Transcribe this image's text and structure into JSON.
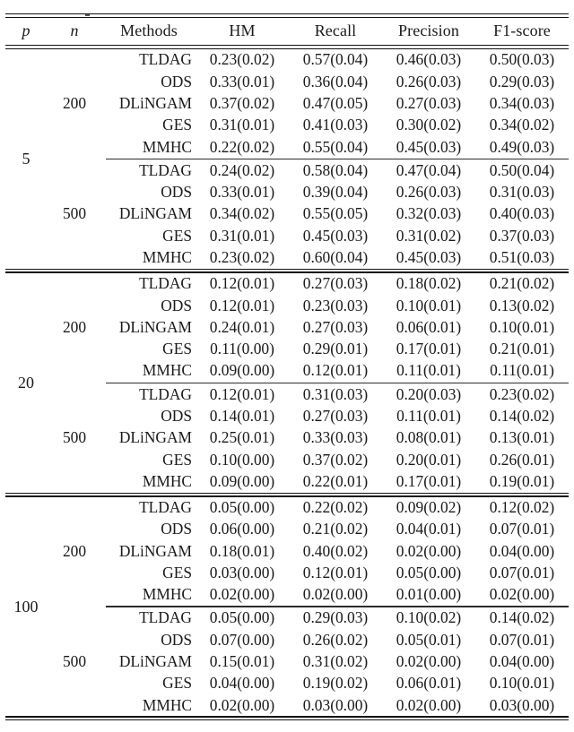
{
  "table": {
    "columns": [
      "p",
      "n",
      "Methods",
      "HM",
      "Recall",
      "Precision",
      "F1-score"
    ],
    "header": {
      "p": "p",
      "n": "n",
      "methods": "Methods",
      "hm": "HM",
      "recall": "Recall",
      "precision": "Precision",
      "f1": "F1-score"
    },
    "groups": [
      {
        "p": "5",
        "subgroups": [
          {
            "n": "200",
            "rows": [
              {
                "method": "TLDAG",
                "hm": "0.23(0.02)",
                "recall": "0.57(0.04)",
                "precision": "0.46(0.03)",
                "f1": "0.50(0.03)"
              },
              {
                "method": "ODS",
                "hm": "0.33(0.01)",
                "recall": "0.36(0.04)",
                "precision": "0.26(0.03)",
                "f1": "0.29(0.03)"
              },
              {
                "method": "DLiNGAM",
                "hm": "0.37(0.02)",
                "recall": "0.47(0.05)",
                "precision": "0.27(0.03)",
                "f1": "0.34(0.03)"
              },
              {
                "method": "GES",
                "hm": "0.31(0.01)",
                "recall": "0.41(0.03)",
                "precision": "0.30(0.02)",
                "f1": "0.34(0.02)"
              },
              {
                "method": "MMHC",
                "hm": "0.22(0.02)",
                "recall": "0.55(0.04)",
                "precision": "0.45(0.03)",
                "f1": "0.49(0.03)"
              }
            ]
          },
          {
            "n": "500",
            "rows": [
              {
                "method": "TLDAG",
                "hm": "0.24(0.02)",
                "recall": "0.58(0.04)",
                "precision": "0.47(0.04)",
                "f1": "0.50(0.04)"
              },
              {
                "method": "ODS",
                "hm": "0.33(0.01)",
                "recall": "0.39(0.04)",
                "precision": "0.26(0.03)",
                "f1": "0.31(0.03)"
              },
              {
                "method": "DLiNGAM",
                "hm": "0.34(0.02)",
                "recall": "0.55(0.05)",
                "precision": "0.32(0.03)",
                "f1": "0.40(0.03)"
              },
              {
                "method": "GES",
                "hm": "0.31(0.01)",
                "recall": "0.45(0.03)",
                "precision": "0.31(0.02)",
                "f1": "0.37(0.03)"
              },
              {
                "method": "MMHC",
                "hm": "0.23(0.02)",
                "recall": "0.60(0.04)",
                "precision": "0.45(0.03)",
                "f1": "0.51(0.03)"
              }
            ]
          }
        ]
      },
      {
        "p": "20",
        "subgroups": [
          {
            "n": "200",
            "rows": [
              {
                "method": "TLDAG",
                "hm": "0.12(0.01)",
                "recall": "0.27(0.03)",
                "precision": "0.18(0.02)",
                "f1": "0.21(0.02)"
              },
              {
                "method": "ODS",
                "hm": "0.12(0.01)",
                "recall": "0.23(0.03)",
                "precision": "0.10(0.01)",
                "f1": "0.13(0.02)"
              },
              {
                "method": "DLiNGAM",
                "hm": "0.24(0.01)",
                "recall": "0.27(0.03)",
                "precision": "0.06(0.01)",
                "f1": "0.10(0.01)"
              },
              {
                "method": "GES",
                "hm": "0.11(0.00)",
                "recall": "0.29(0.01)",
                "precision": "0.17(0.01)",
                "f1": "0.21(0.01)"
              },
              {
                "method": "MMHC",
                "hm": "0.09(0.00)",
                "recall": "0.12(0.01)",
                "precision": "0.11(0.01)",
                "f1": "0.11(0.01)"
              }
            ]
          },
          {
            "n": "500",
            "rows": [
              {
                "method": "TLDAG",
                "hm": "0.12(0.01)",
                "recall": "0.31(0.03)",
                "precision": "0.20(0.03)",
                "f1": "0.23(0.02)"
              },
              {
                "method": "ODS",
                "hm": "0.14(0.01)",
                "recall": "0.27(0.03)",
                "precision": "0.11(0.01)",
                "f1": "0.14(0.02)"
              },
              {
                "method": "DLiNGAM",
                "hm": "0.25(0.01)",
                "recall": "0.33(0.03)",
                "precision": "0.08(0.01)",
                "f1": "0.13(0.01)"
              },
              {
                "method": "GES",
                "hm": "0.10(0.00)",
                "recall": "0.37(0.02)",
                "precision": "0.20(0.01)",
                "f1": "0.26(0.01)"
              },
              {
                "method": "MMHC",
                "hm": "0.09(0.00)",
                "recall": "0.22(0.01)",
                "precision": "0.17(0.01)",
                "f1": "0.19(0.01)"
              }
            ]
          }
        ]
      },
      {
        "p": "100",
        "subgroups": [
          {
            "n": "200",
            "rows": [
              {
                "method": "TLDAG",
                "hm": "0.05(0.00)",
                "recall": "0.22(0.02)",
                "precision": "0.09(0.02)",
                "f1": "0.12(0.02)"
              },
              {
                "method": "ODS",
                "hm": "0.06(0.00)",
                "recall": "0.21(0.02)",
                "precision": "0.04(0.01)",
                "f1": "0.07(0.01)"
              },
              {
                "method": "DLiNGAM",
                "hm": "0.18(0.01)",
                "recall": "0.40(0.02)",
                "precision": "0.02(0.00)",
                "f1": "0.04(0.00)"
              },
              {
                "method": "GES",
                "hm": "0.03(0.00)",
                "recall": "0.12(0.01)",
                "precision": "0.05(0.00)",
                "f1": "0.07(0.01)"
              },
              {
                "method": "MMHC",
                "hm": "0.02(0.00)",
                "recall": "0.02(0.00)",
                "precision": "0.01(0.00)",
                "f1": "0.02(0.00)"
              }
            ]
          },
          {
            "n": "500",
            "rows": [
              {
                "method": "TLDAG",
                "hm": "0.05(0.00)",
                "recall": "0.29(0.03)",
                "precision": "0.10(0.02)",
                "f1": "0.14(0.02)"
              },
              {
                "method": "ODS",
                "hm": "0.07(0.00)",
                "recall": "0.26(0.02)",
                "precision": "0.05(0.01)",
                "f1": "0.07(0.01)"
              },
              {
                "method": "DLiNGAM",
                "hm": "0.15(0.01)",
                "recall": "0.31(0.02)",
                "precision": "0.02(0.00)",
                "f1": "0.04(0.00)"
              },
              {
                "method": "GES",
                "hm": "0.04(0.00)",
                "recall": "0.19(0.02)",
                "precision": "0.06(0.01)",
                "f1": "0.10(0.01)"
              },
              {
                "method": "MMHC",
                "hm": "0.02(0.00)",
                "recall": "0.03(0.00)",
                "precision": "0.02(0.00)",
                "f1": "0.03(0.00)"
              }
            ]
          }
        ]
      }
    ]
  }
}
